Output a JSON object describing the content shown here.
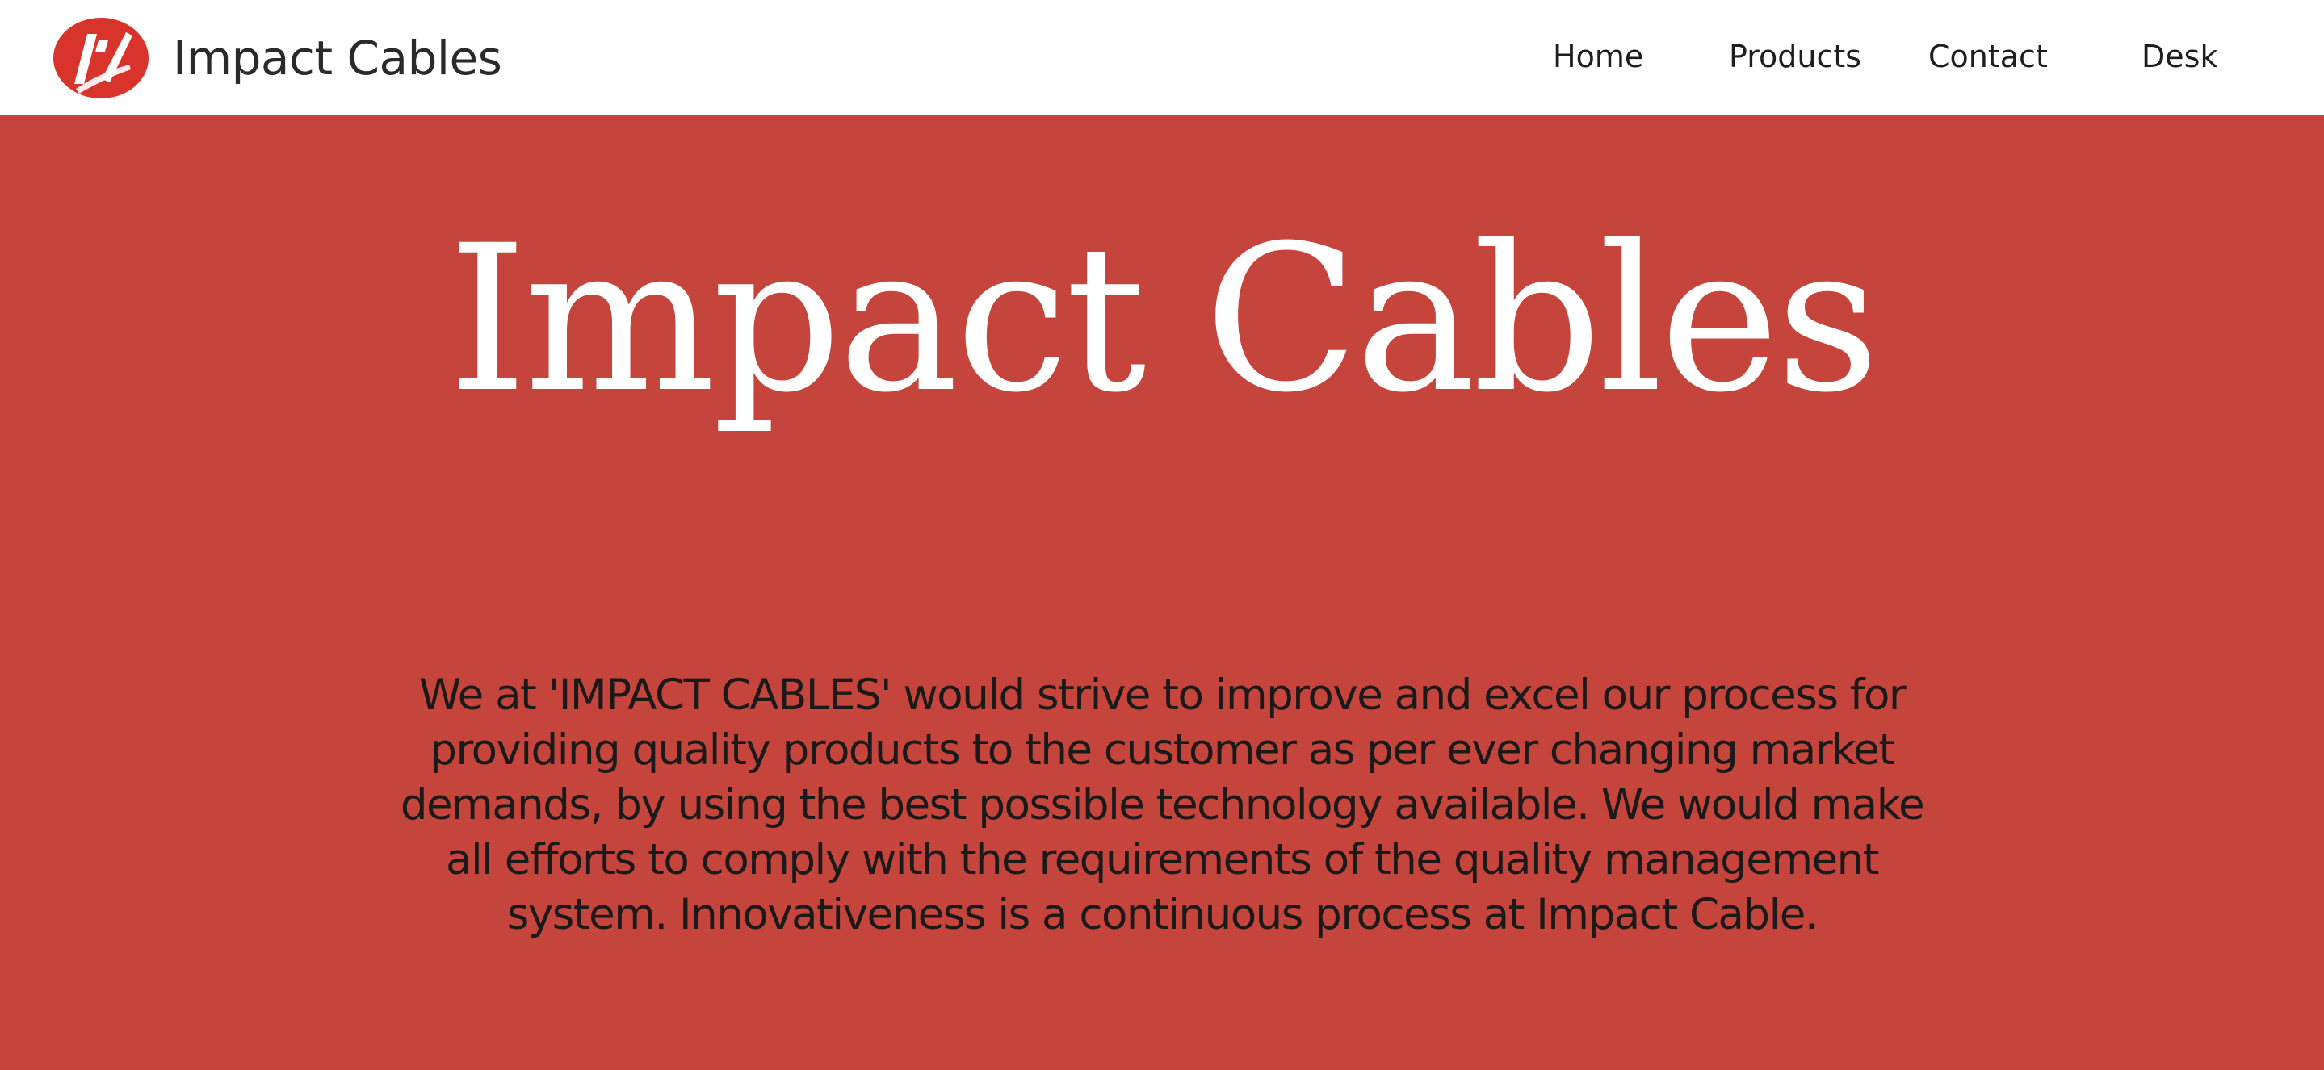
{
  "brand": {
    "name": "Impact Cables",
    "logo_icon": "impact-cables-logo-icon",
    "logo_color": "#d9342b"
  },
  "nav": {
    "items": [
      {
        "label": "Home"
      },
      {
        "label": "Products"
      },
      {
        "label": "Contact"
      },
      {
        "label": "Desk"
      }
    ]
  },
  "hero": {
    "title": "Impact Cables",
    "description": "We at 'IMPACT CABLES' would strive to improve and excel our process for providing quality products to the customer as per ever changing market demands, by using the best possible technology available. We would make all efforts to comply with the requirements of the quality management system. Innovativeness is a continuous process at Impact Cable.",
    "background_color": "#c5443c",
    "title_color": "#ffffff"
  }
}
